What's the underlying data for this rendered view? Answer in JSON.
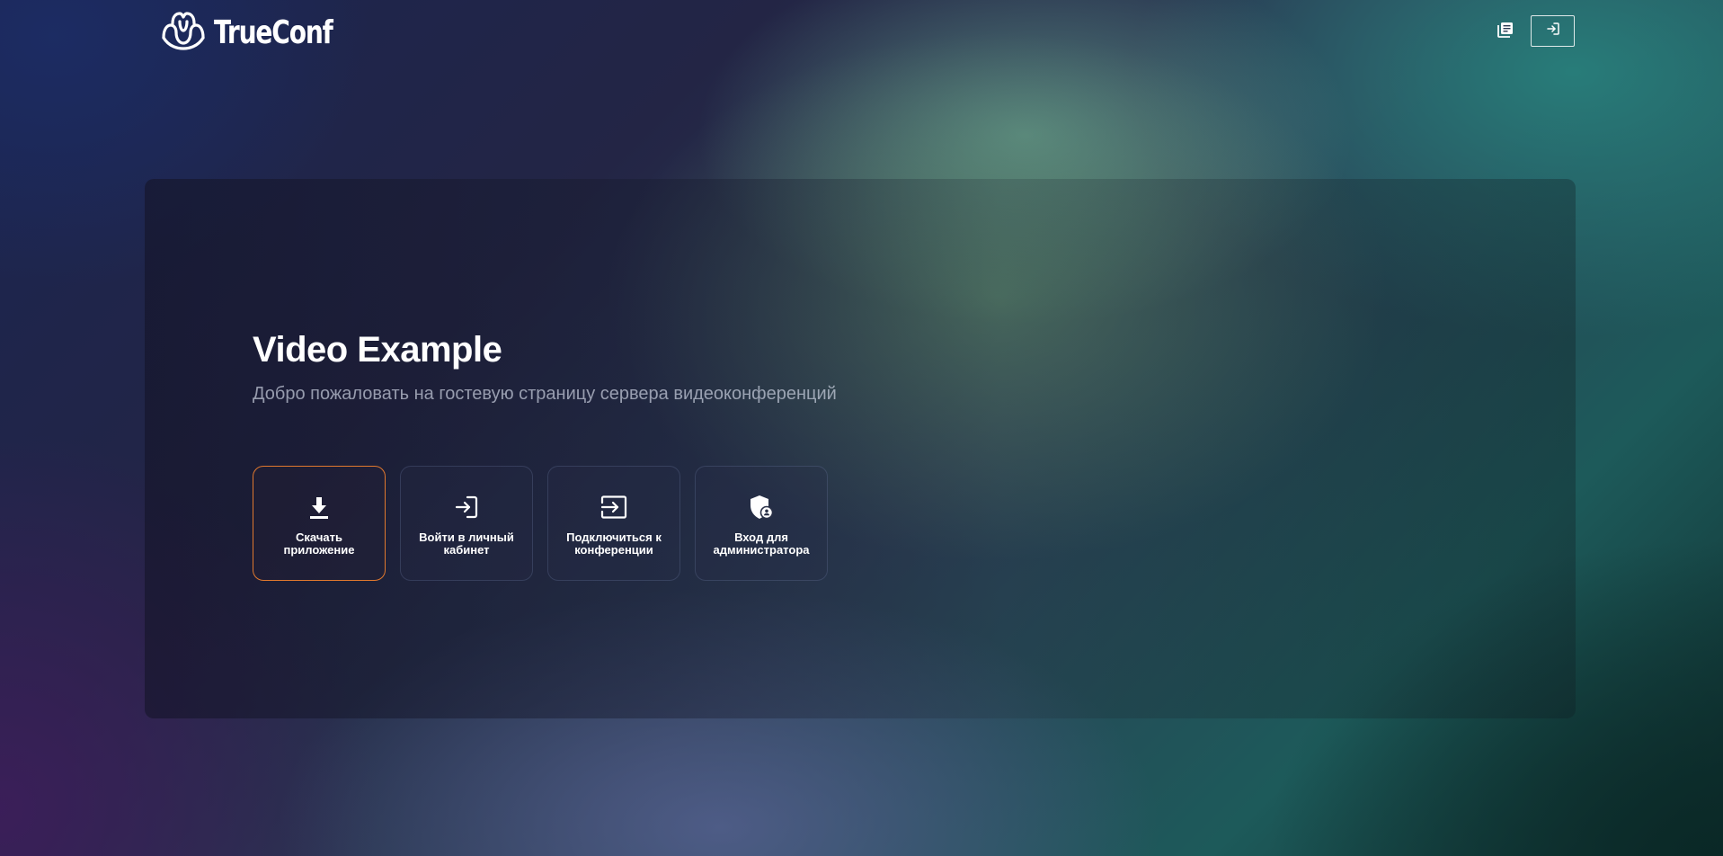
{
  "header": {
    "logo_text": "TrueConf",
    "logo_icon": "trueconf-logo-icon",
    "docs_icon": "docs-icon",
    "login_icon": "login-icon"
  },
  "main": {
    "title": "Video Example",
    "subtitle": "Добро пожаловать на гостевую страницу сервера видеоконференций",
    "actions": [
      {
        "label": "Скачать приложение",
        "icon": "download-icon",
        "active": true
      },
      {
        "label": "Войти в личный кабинет",
        "icon": "login-icon",
        "active": false
      },
      {
        "label": "Подключиться к конференции",
        "icon": "join-conference-icon",
        "active": false
      },
      {
        "label": "Вход для администратора",
        "icon": "admin-shield-icon",
        "active": false
      }
    ]
  },
  "colors": {
    "accent": "#e0782e",
    "text_primary": "#ffffff",
    "text_secondary": "#b4b9c8"
  }
}
